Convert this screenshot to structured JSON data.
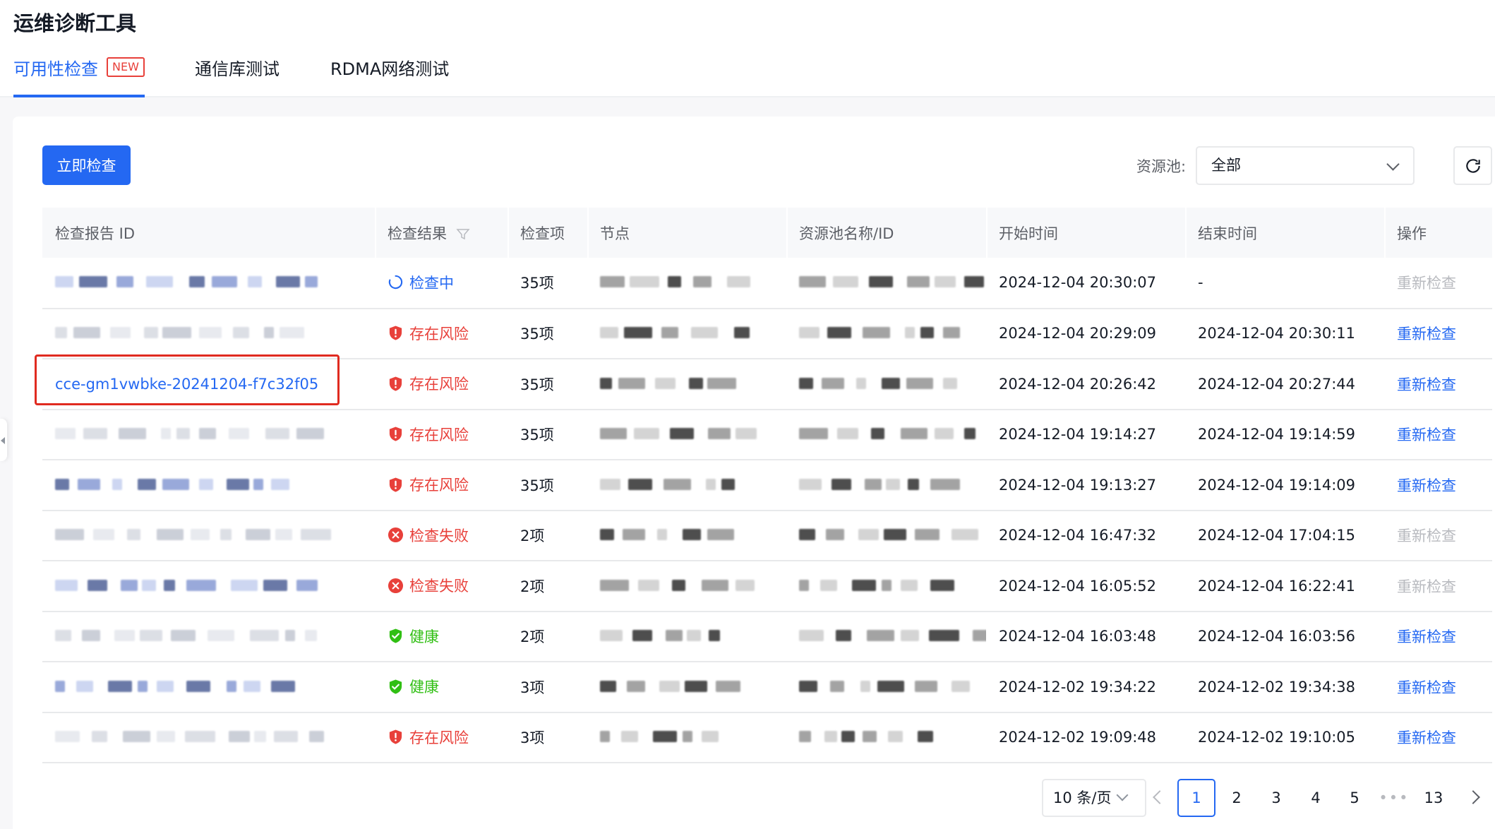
{
  "page": {
    "title": "运维诊断工具"
  },
  "tabs": [
    {
      "label": "可用性检查",
      "badge": "NEW"
    },
    {
      "label": "通信库测试"
    },
    {
      "label": "RDMA网络测试"
    }
  ],
  "toolbar": {
    "check_now": "立即检查",
    "pool_label": "资源池:",
    "pool_value": "全部"
  },
  "table": {
    "headers": [
      "检查报告 ID",
      "检查结果",
      "检查项",
      "节点",
      "资源池名称/ID",
      "开始时间",
      "结束时间",
      "操作"
    ],
    "rows": [
      {
        "id": "",
        "status": "检查中",
        "status_type": "running",
        "items": "35项",
        "start": "2024-12-04 20:30:07",
        "end": "-",
        "action": "重新检查",
        "action_enabled": false
      },
      {
        "id": "",
        "status": "存在风险",
        "status_type": "risk",
        "items": "35项",
        "start": "2024-12-04 20:29:09",
        "end": "2024-12-04 20:30:11",
        "action": "重新检查",
        "action_enabled": true
      },
      {
        "id": "cce-gm1vwbke-20241204-f7c32f05",
        "status": "存在风险",
        "status_type": "risk",
        "items": "35项",
        "start": "2024-12-04 20:26:42",
        "end": "2024-12-04 20:27:44",
        "action": "重新检查",
        "action_enabled": true
      },
      {
        "id": "",
        "status": "存在风险",
        "status_type": "risk",
        "items": "35项",
        "start": "2024-12-04 19:14:27",
        "end": "2024-12-04 19:14:59",
        "action": "重新检查",
        "action_enabled": true
      },
      {
        "id": "",
        "status": "存在风险",
        "status_type": "risk",
        "items": "35项",
        "start": "2024-12-04 19:13:27",
        "end": "2024-12-04 19:14:09",
        "action": "重新检查",
        "action_enabled": true
      },
      {
        "id": "",
        "status": "检查失败",
        "status_type": "failed",
        "items": "2项",
        "start": "2024-12-04 16:47:32",
        "end": "2024-12-04 17:04:15",
        "action": "重新检查",
        "action_enabled": false
      },
      {
        "id": "",
        "status": "检查失败",
        "status_type": "failed",
        "items": "2项",
        "start": "2024-12-04 16:05:52",
        "end": "2024-12-04 16:22:41",
        "action": "重新检查",
        "action_enabled": false
      },
      {
        "id": "",
        "status": "健康",
        "status_type": "healthy",
        "items": "2项",
        "start": "2024-12-04 16:03:48",
        "end": "2024-12-04 16:03:56",
        "action": "重新检查",
        "action_enabled": true
      },
      {
        "id": "",
        "status": "健康",
        "status_type": "healthy",
        "items": "3项",
        "start": "2024-12-02 19:34:22",
        "end": "2024-12-02 19:34:38",
        "action": "重新检查",
        "action_enabled": true
      },
      {
        "id": "",
        "status": "存在风险",
        "status_type": "risk",
        "items": "3项",
        "start": "2024-12-02 19:09:48",
        "end": "2024-12-02 19:10:05",
        "action": "重新检查",
        "action_enabled": true
      }
    ]
  },
  "pagination": {
    "page_size": "10 条/页",
    "pages": [
      "1",
      "2",
      "3",
      "4",
      "5"
    ],
    "ellipsis": "•••",
    "last": "13",
    "current": "1"
  },
  "colors": {
    "accent": "#2468f2",
    "danger": "#e8403a",
    "success": "#30bf13",
    "highlight": "#e02b20"
  }
}
